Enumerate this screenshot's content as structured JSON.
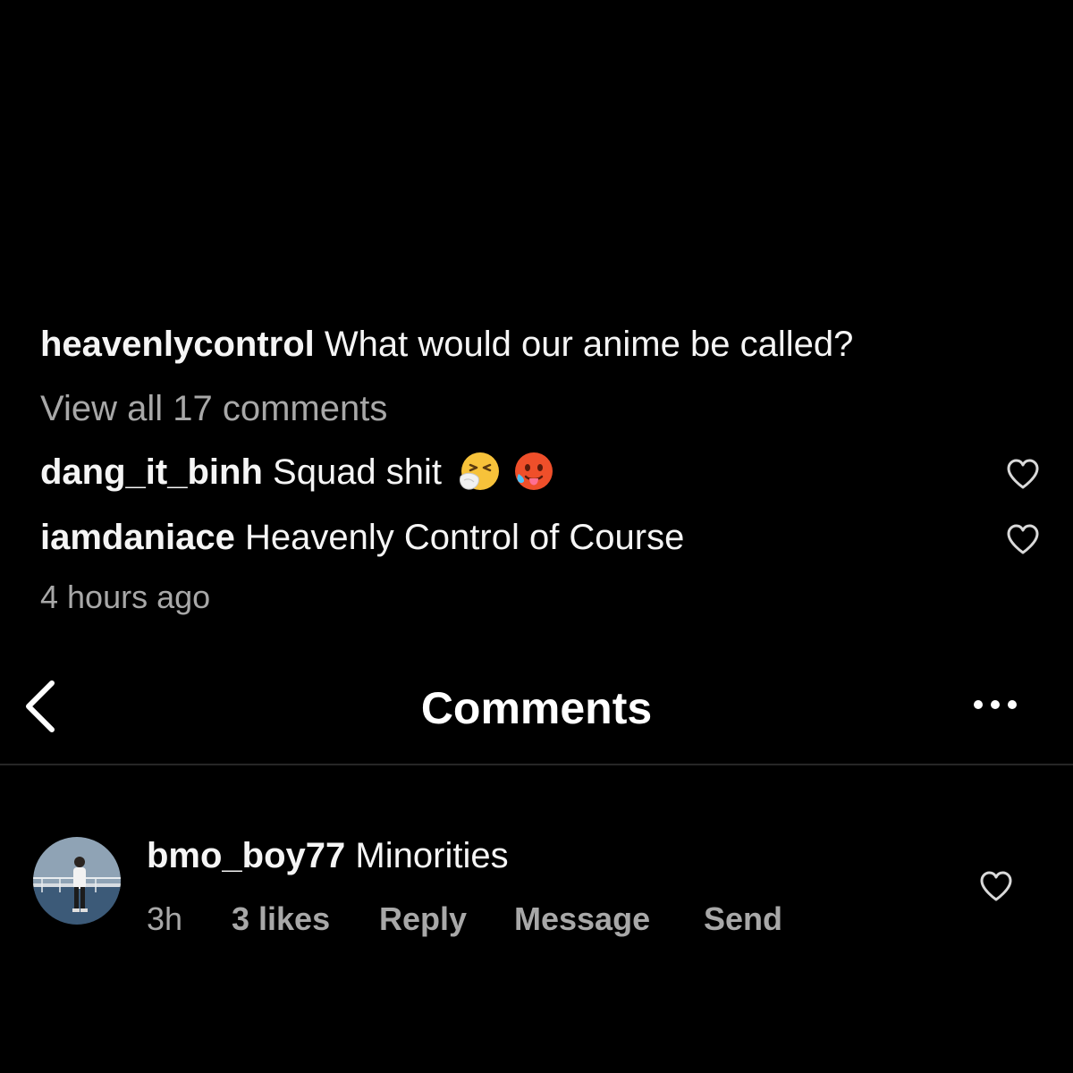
{
  "post_preview": {
    "caption": {
      "username": "heavenlycontrol",
      "text": "What would our anime be called?"
    },
    "view_all_label": "View all 17 comments",
    "comments": [
      {
        "username": "dang_it_binh",
        "text": "Squad shit",
        "emojis": [
          "sneezing-face-emoji",
          "hot-face-emoji"
        ]
      },
      {
        "username": "iamdaniace",
        "text": "Heavenly Control of Course"
      }
    ],
    "timestamp": "4 hours ago"
  },
  "header": {
    "title": "Comments",
    "back_icon": "chevron-left-icon",
    "more_icon": "more-horizontal-icon"
  },
  "comment": {
    "username": "bmo_boy77",
    "text": "Minorities",
    "time": "3h",
    "likes": "3 likes",
    "actions": [
      "Reply",
      "Message",
      "Send"
    ]
  },
  "colors": {
    "background": "#000000",
    "text": "#f5f5f5",
    "muted": "#a8a8a8",
    "divider": "#262626"
  }
}
